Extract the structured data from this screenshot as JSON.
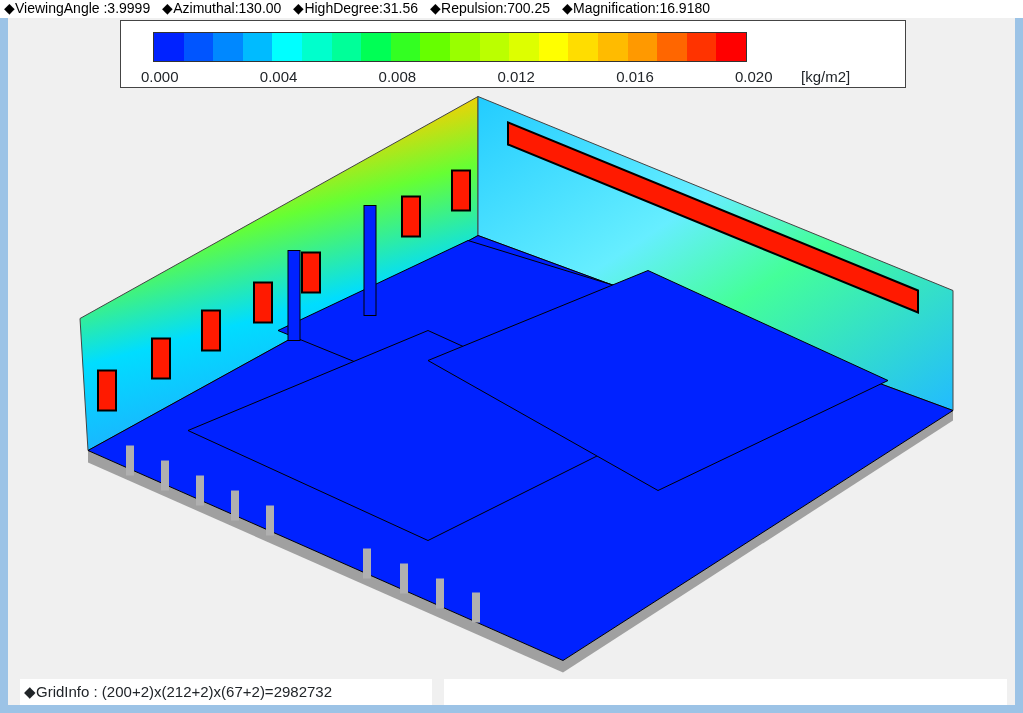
{
  "header": [
    {
      "label": "◆ViewingAngle :3.9999"
    },
    {
      "label": "◆Azimuthal:130.00"
    },
    {
      "label": "◆HighDegree:31.56"
    },
    {
      "label": "◆Repulsion:700.25"
    },
    {
      "label": "◆Magnification:16.9180"
    }
  ],
  "legend": {
    "colors": [
      {
        "color": "#0022ff"
      },
      {
        "color": "#0055ff"
      },
      {
        "color": "#0088ff"
      },
      {
        "color": "#00bbff"
      },
      {
        "color": "#00ffff"
      },
      {
        "color": "#00ffcc"
      },
      {
        "color": "#00ff99"
      },
      {
        "color": "#00ff55"
      },
      {
        "color": "#33ff22"
      },
      {
        "color": "#66ff00"
      },
      {
        "color": "#99ff00"
      },
      {
        "color": "#bbff00"
      },
      {
        "color": "#ddff00"
      },
      {
        "color": "#ffff00"
      },
      {
        "color": "#ffdd00"
      },
      {
        "color": "#ffbb00"
      },
      {
        "color": "#ff9900"
      },
      {
        "color": "#ff6600"
      },
      {
        "color": "#ff3300"
      },
      {
        "color": "#ff0000"
      }
    ],
    "ticks": [
      "0.000",
      "0.004",
      "0.008",
      "0.012",
      "0.016",
      "0.020"
    ],
    "unit": "[kg/m2]"
  },
  "grid_info": "◆GridInfo : (200+2)x(212+2)x(67+2)=2982732"
}
